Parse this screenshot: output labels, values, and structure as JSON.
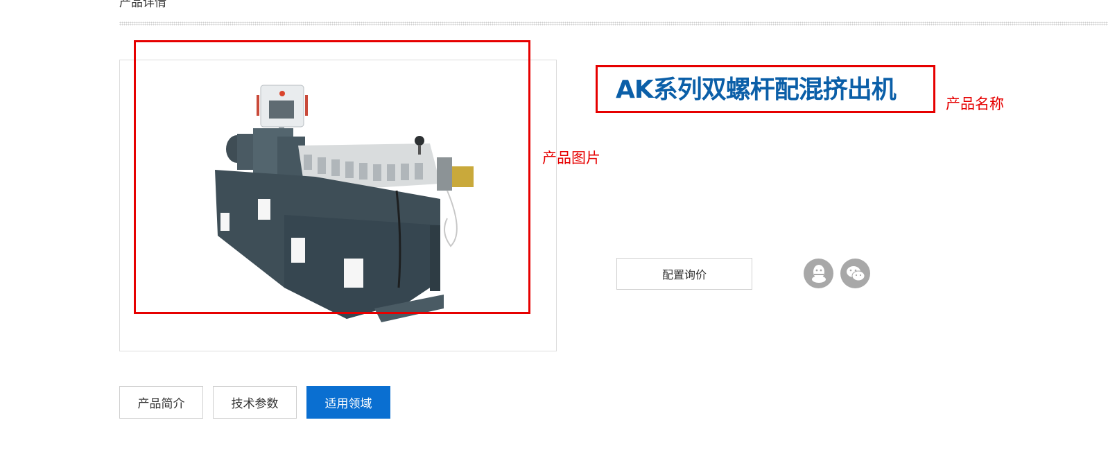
{
  "section": {
    "title": "产品详情"
  },
  "product": {
    "name": "AK系列双螺杆配混挤出机",
    "image_alt": "AK系列双螺杆配混挤出机"
  },
  "annotations": {
    "image_label": "产品图片",
    "name_label": "产品名称",
    "color": "#e60000"
  },
  "actions": {
    "inquiry_label": "配置询价"
  },
  "social": {
    "icons": [
      "qq-icon",
      "wechat-icon"
    ]
  },
  "tabs": [
    {
      "label": "产品简介",
      "active": false
    },
    {
      "label": "技术参数",
      "active": false
    },
    {
      "label": "适用领域",
      "active": true
    }
  ],
  "colors": {
    "accent": "#0a6fd1",
    "title": "#0b5fa8",
    "social_icon_bg": "#a8a8a8"
  }
}
